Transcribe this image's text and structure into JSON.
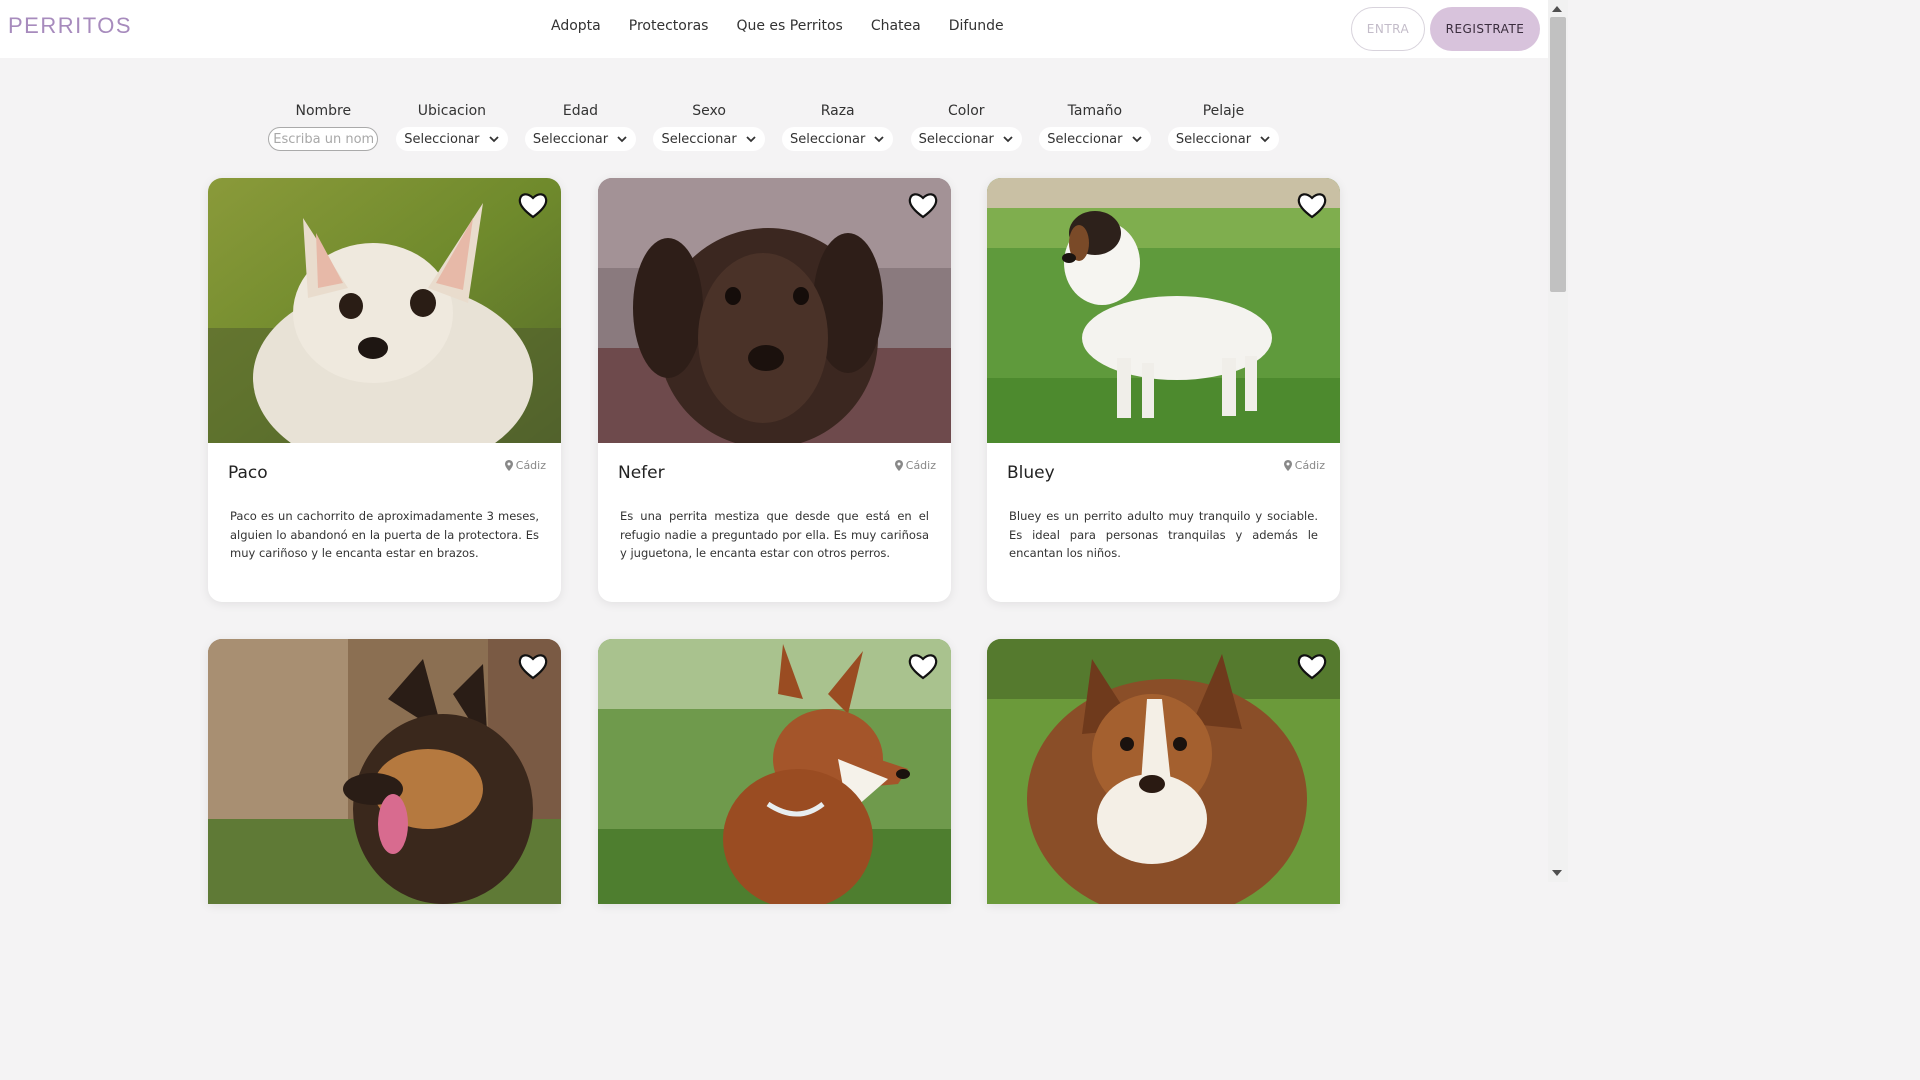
{
  "header": {
    "logo": "PERRITOS",
    "nav": [
      "Adopta",
      "Protectoras",
      "Que es Perritos",
      "Chatea",
      "Difunde"
    ],
    "login_label": "ENTRA",
    "register_label": "REGISTRATE"
  },
  "filters": {
    "name": {
      "label": "Nombre",
      "placeholder": "Escriba un nombre"
    },
    "selects": [
      {
        "label": "Ubicacion",
        "value": "Seleccionar"
      },
      {
        "label": "Edad",
        "value": "Seleccionar"
      },
      {
        "label": "Sexo",
        "value": "Seleccionar"
      },
      {
        "label": "Raza",
        "value": "Seleccionar"
      },
      {
        "label": "Color",
        "value": "Seleccionar"
      },
      {
        "label": "Tamaño",
        "value": "Seleccionar"
      },
      {
        "label": "Pelaje",
        "value": "Seleccionar"
      }
    ]
  },
  "dogs": [
    {
      "name": "Paco",
      "location": "Cádiz",
      "description": "Paco es un cachorrito de aproximadamente 3 meses, alguien lo abandonó en la puerta de la protectora. Es muy cariñoso y le encanta estar en brazos."
    },
    {
      "name": "Nefer",
      "location": "Cádiz",
      "description": "Es una perrita mestiza que desde que está en el refugio nadie a preguntado por ella. Es muy cariñosa y juguetona, le encanta estar con otros perros."
    },
    {
      "name": "Bluey",
      "location": "Cádiz",
      "description": "Bluey es un perrito adulto muy tranquilo y sociable. Es ideal para personas tranquilas y además le encantan los niños."
    }
  ],
  "colors": {
    "brand": "#a78bbd",
    "register_bg": "#d8c3dc",
    "page_bg": "#f4f3f4"
  },
  "icons": [
    "heart-icon",
    "location-pin-icon",
    "chevron-down-icon"
  ]
}
